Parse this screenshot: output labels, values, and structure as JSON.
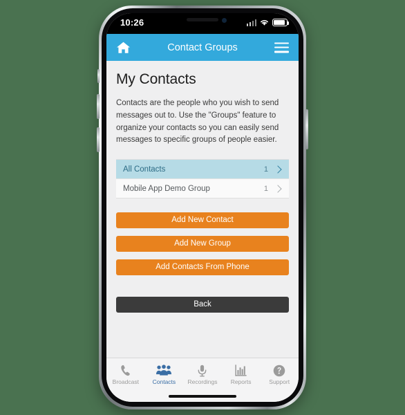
{
  "theme": {
    "page_background": "#4a7250",
    "header_blue": "#33a9dc",
    "accent_orange": "#e8821e",
    "dark_button": "#3b3b3b",
    "selected_row": "#b6dbe6",
    "active_tab": "#3a6ea5"
  },
  "status_bar": {
    "time": "10:26",
    "signal_icon": "signal-bars-icon",
    "wifi_icon": "wifi-icon",
    "battery_icon": "battery-icon"
  },
  "header": {
    "home_icon": "home-icon",
    "title": "Contact Groups",
    "menu_icon": "hamburger-menu-icon"
  },
  "main": {
    "title": "My Contacts",
    "description": "Contacts are the people who you wish to send messages out to. Use the \"Groups\" feature to organize your contacts so you can easily send messages to specific groups of people easier.",
    "groups": [
      {
        "label": "All Contacts",
        "count": "1",
        "selected": true,
        "chevron_icon": "chevron-right-icon"
      },
      {
        "label": "Mobile App Demo Group",
        "count": "1",
        "selected": false,
        "chevron_icon": "chevron-right-icon"
      }
    ],
    "actions": [
      {
        "label": "Add New Contact"
      },
      {
        "label": "Add New Group"
      },
      {
        "label": "Add Contacts From Phone"
      }
    ],
    "back_label": "Back"
  },
  "tabbar": {
    "tabs": [
      {
        "label": "Broadcast",
        "icon": "phone-icon",
        "active": false
      },
      {
        "label": "Contacts",
        "icon": "people-icon",
        "active": true
      },
      {
        "label": "Recordings",
        "icon": "microphone-icon",
        "active": false
      },
      {
        "label": "Reports",
        "icon": "bar-chart-icon",
        "active": false
      },
      {
        "label": "Support",
        "icon": "help-circle-icon",
        "active": false
      }
    ]
  }
}
